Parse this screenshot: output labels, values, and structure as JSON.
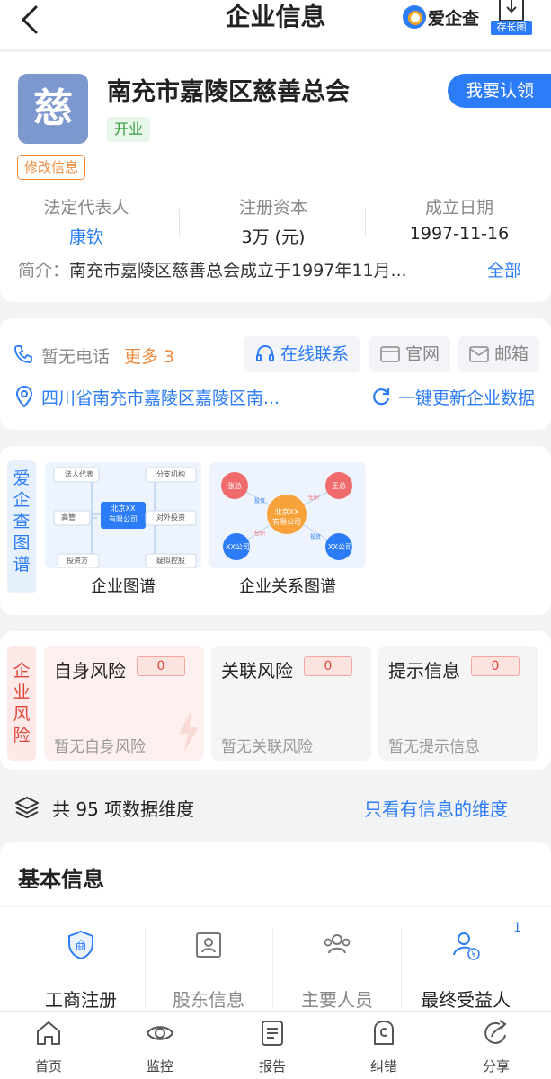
{
  "header": {
    "title": "企业信息",
    "brand": "爱企查",
    "save_label": "存长图"
  },
  "company": {
    "logo_char": "慈",
    "name": "南充市嘉陵区慈善总会",
    "status": "开业",
    "modify_label": "修改信息",
    "claim_label": "我要认领",
    "stats": [
      {
        "label": "法定代表人",
        "value": "康钦"
      },
      {
        "label": "注册资本",
        "value": "3万 (元)"
      },
      {
        "label": "成立日期",
        "value": "1997-11-16"
      }
    ],
    "intro_label": "简介：",
    "intro_text": "南充市嘉陵区慈善总会成立于1997年11月...",
    "intro_more": "全部"
  },
  "contact": {
    "phone": "暂无电话",
    "more": "更多 3",
    "online": "在线联系",
    "website": "官网",
    "email": "邮箱",
    "address": "四川省南充市嘉陵区嘉陵区南...",
    "refresh": "一键更新企业数据"
  },
  "graph": {
    "side_label": [
      "爱",
      "企",
      "查",
      "图",
      "谱"
    ],
    "items": [
      {
        "caption": "企业图谱",
        "center": [
          "北京XX",
          "有限公司"
        ],
        "nodes": [
          "法人代表",
          "分支机构",
          "高管",
          "对外投资",
          "投资方",
          "疑似控股"
        ]
      },
      {
        "caption": "企业关系图谱",
        "center": [
          "北京XX",
          "有限公司"
        ],
        "nodes": [
          "张总",
          "王总",
          "XX公司",
          "XX公司"
        ],
        "edges": [
          "投资",
          "任职",
          "任职",
          "投资"
        ]
      }
    ]
  },
  "risk": {
    "side_label": [
      "企",
      "业",
      "风",
      "险"
    ],
    "tiles": [
      {
        "title": "自身风险",
        "count": "0",
        "sub": "暂无自身风险"
      },
      {
        "title": "关联风险",
        "count": "0",
        "sub": "暂无关联风险"
      },
      {
        "title": "提示信息",
        "count": "0",
        "sub": "暂无提示信息"
      }
    ]
  },
  "dimensions": {
    "text": "共 95 项数据维度",
    "link": "只看有信息的维度"
  },
  "basic": {
    "title": "基本信息",
    "badge_count": "1",
    "items": [
      {
        "label": "工商注册",
        "icon": "shield-icon"
      },
      {
        "label": "股东信息",
        "icon": "id-card-icon"
      },
      {
        "label": "主要人员",
        "icon": "people-icon"
      },
      {
        "label": "最终受益人",
        "icon": "beneficiary-icon"
      }
    ]
  },
  "nav": [
    {
      "label": "首页",
      "icon": "home-icon"
    },
    {
      "label": "监控",
      "icon": "eye-icon"
    },
    {
      "label": "报告",
      "icon": "report-icon"
    },
    {
      "label": "纠错",
      "icon": "correction-icon"
    },
    {
      "label": "分享",
      "icon": "share-icon"
    }
  ],
  "colors": {
    "accent": "#2b7cf6",
    "risk": "#e2443a",
    "orange": "#f08a3c",
    "green": "#2e9c3c"
  }
}
